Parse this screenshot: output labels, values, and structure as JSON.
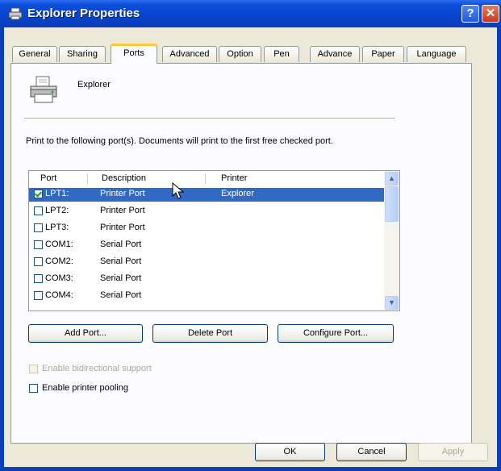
{
  "window": {
    "title": "Explorer Properties"
  },
  "tabs": [
    {
      "label": "General"
    },
    {
      "label": "Sharing"
    },
    {
      "label": "Ports"
    },
    {
      "label": "Advanced"
    },
    {
      "label": "Option"
    },
    {
      "label": "Pen"
    },
    {
      "label": "Advance"
    },
    {
      "label": "Paper"
    },
    {
      "label": "Language"
    }
  ],
  "active_tab": "Ports",
  "printer": {
    "name": "Explorer"
  },
  "description": "Print to the following port(s). Documents will print to the first free checked port.",
  "ports_list": {
    "columns": [
      "Port",
      "Description",
      "Printer"
    ],
    "rows": [
      {
        "port": "LPT1:",
        "description": "Printer Port",
        "printer": "Explorer",
        "checked": true,
        "selected": true
      },
      {
        "port": "LPT2:",
        "description": "Printer Port",
        "printer": "",
        "checked": false,
        "selected": false
      },
      {
        "port": "LPT3:",
        "description": "Printer Port",
        "printer": "",
        "checked": false,
        "selected": false
      },
      {
        "port": "COM1:",
        "description": "Serial Port",
        "printer": "",
        "checked": false,
        "selected": false
      },
      {
        "port": "COM2:",
        "description": "Serial Port",
        "printer": "",
        "checked": false,
        "selected": false
      },
      {
        "port": "COM3:",
        "description": "Serial Port",
        "printer": "",
        "checked": false,
        "selected": false
      },
      {
        "port": "COM4:",
        "description": "Serial Port",
        "printer": "",
        "checked": false,
        "selected": false
      }
    ]
  },
  "port_buttons": {
    "add": "Add Port...",
    "delete": "Delete Port",
    "configure": "Configure Port..."
  },
  "options": {
    "bidirectional": {
      "label": "Enable bidirectional support",
      "checked": false,
      "enabled": false
    },
    "pooling": {
      "label": "Enable printer pooling",
      "checked": false,
      "enabled": true
    }
  },
  "dialog_buttons": {
    "ok": "OK",
    "cancel": "Cancel",
    "apply": "Apply"
  },
  "colors": {
    "titlebar": "#0c4fdb",
    "selection": "#316ac5",
    "active_tab_accent": "#ffc83c",
    "dialog_bg": "#ece9d8"
  }
}
